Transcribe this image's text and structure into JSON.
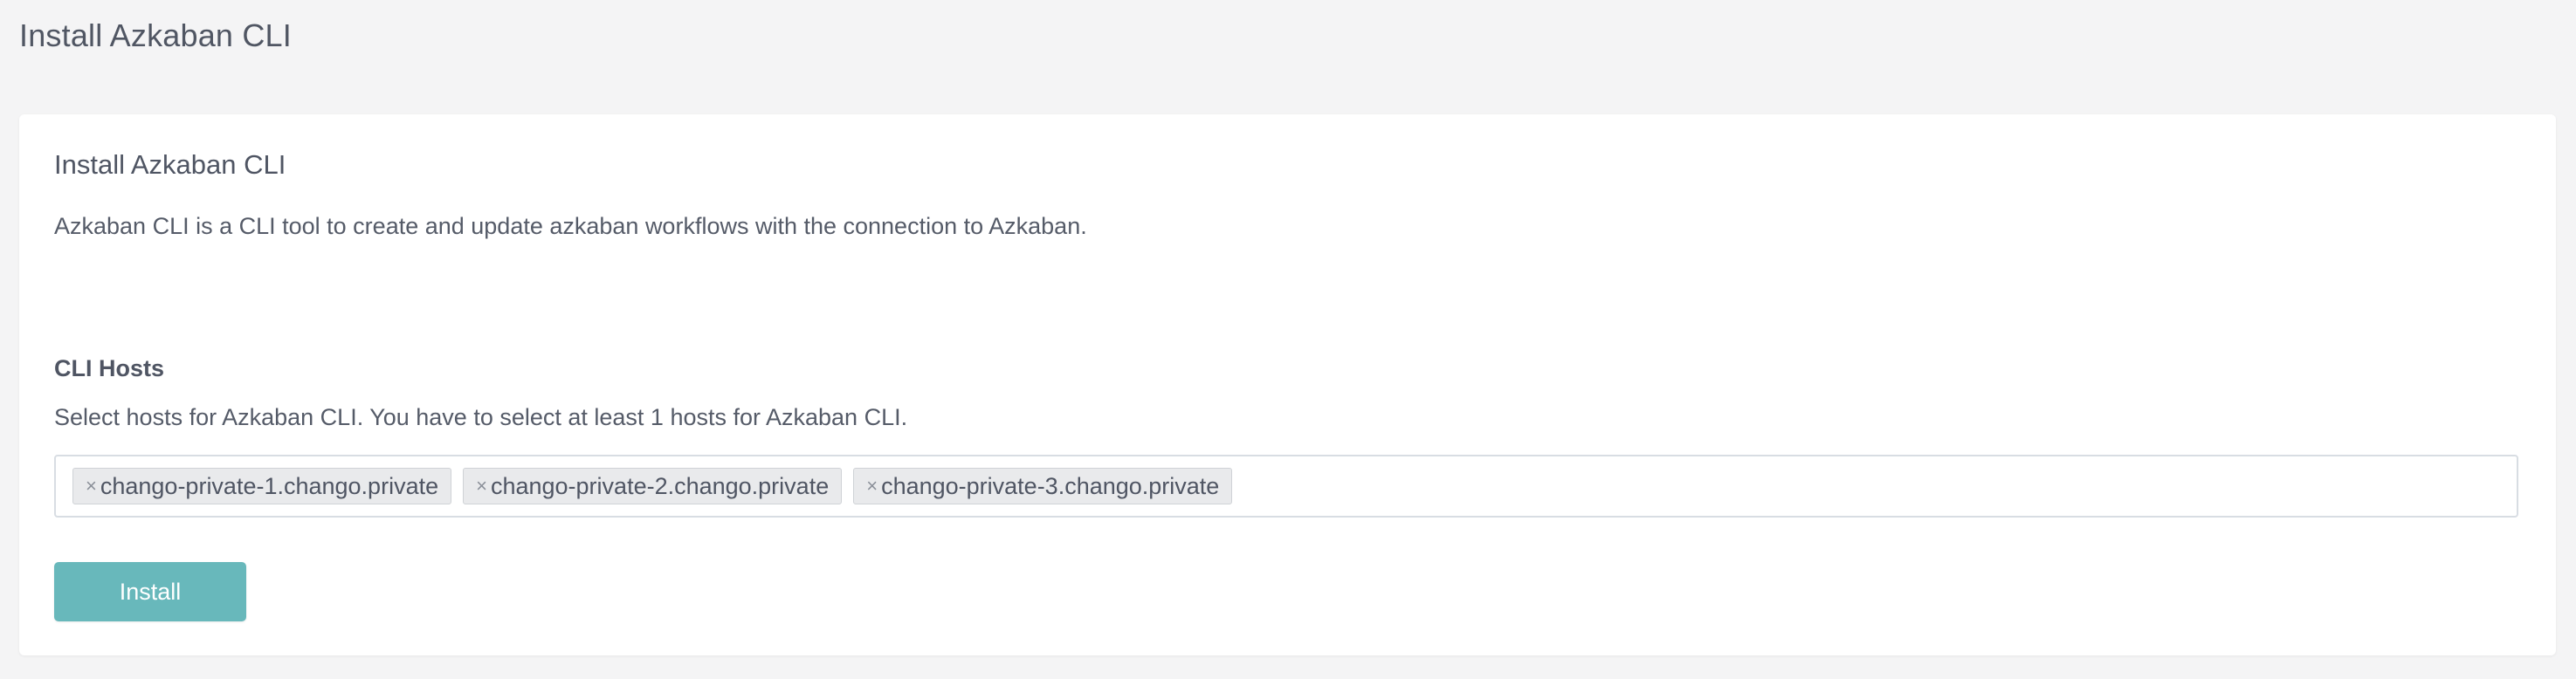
{
  "header": {
    "title": "Install Azkaban CLI"
  },
  "card": {
    "title": "Install Azkaban CLI",
    "description": "Azkaban CLI is a CLI tool to create and update azkaban workflows with the connection to Azkaban."
  },
  "cli_hosts": {
    "label": "CLI Hosts",
    "help": "Select hosts for Azkaban CLI. You have to select at least 1 hosts for Azkaban CLI.",
    "remove_glyph": "×",
    "selected": [
      "chango-private-1.chango.private",
      "chango-private-2.chango.private",
      "chango-private-3.chango.private"
    ]
  },
  "actions": {
    "install_label": "Install"
  },
  "colors": {
    "background": "#f4f4f5",
    "button": "#68b8bb",
    "text": "#4f5563"
  }
}
